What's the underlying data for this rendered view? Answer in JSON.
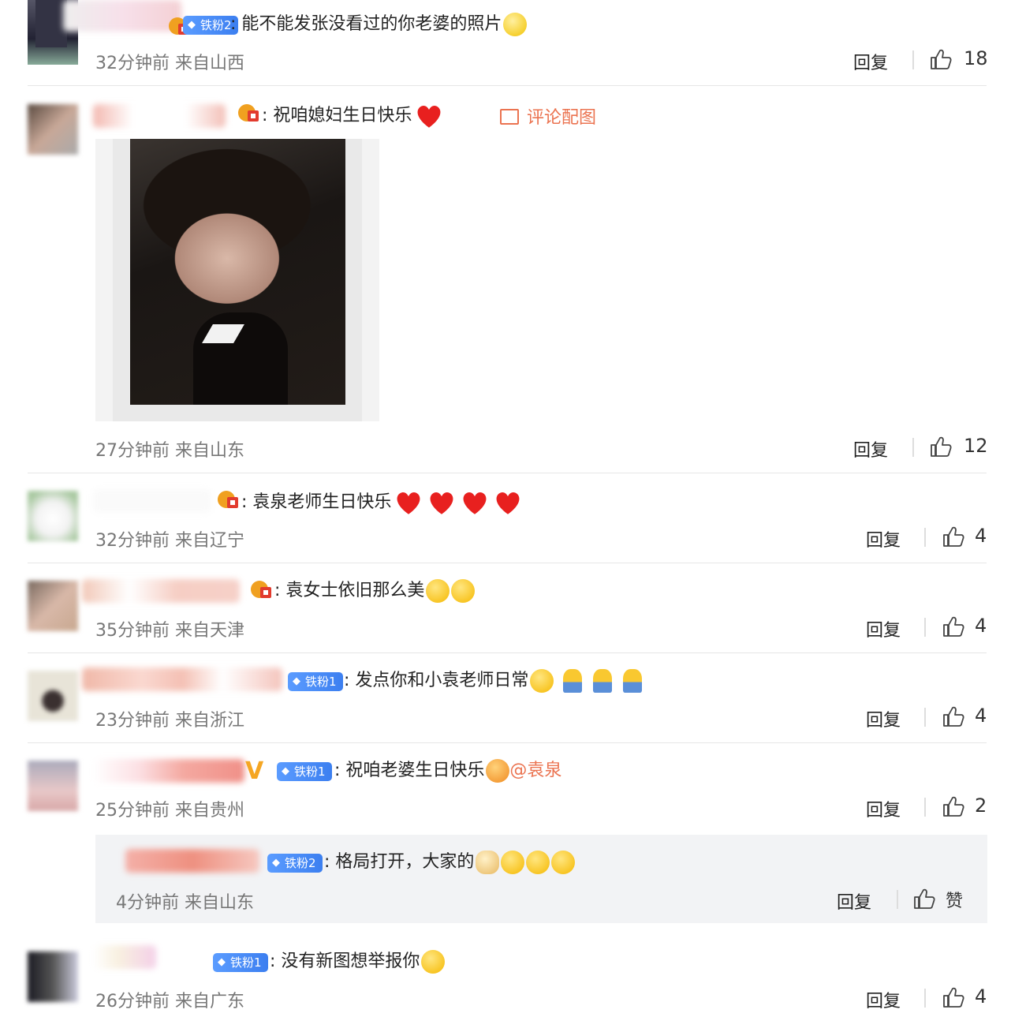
{
  "comments": [
    {
      "badge": "铁粉2",
      "text": "能不能发张没看过的你老婆的照片",
      "time": "32分钟前",
      "source": "来自山西",
      "reply_label": "回复",
      "likes": "18"
    },
    {
      "text": "祝咱媳妇生日快乐",
      "image_link": "评论配图",
      "time": "27分钟前",
      "source": "来自山东",
      "reply_label": "回复",
      "likes": "12"
    },
    {
      "text": "袁泉老师生日快乐",
      "time": "32分钟前",
      "source": "来自辽宁",
      "reply_label": "回复",
      "likes": "4"
    },
    {
      "text": "袁女士依旧那么美",
      "time": "35分钟前",
      "source": "来自天津",
      "reply_label": "回复",
      "likes": "4"
    },
    {
      "badge": "铁粉1",
      "text": "发点你和小袁老师日常",
      "time": "23分钟前",
      "source": "来自浙江",
      "reply_label": "回复",
      "likes": "4"
    },
    {
      "badge": "铁粉1",
      "text": "祝咱老婆生日快乐",
      "mention": "@袁泉",
      "time": "25分钟前",
      "source": "来自贵州",
      "reply_label": "回复",
      "likes": "2",
      "sub_reply": {
        "badge": "铁粉2",
        "text": "格局打开，大家的",
        "time": "4分钟前",
        "source": "来自山东",
        "reply_label": "回复",
        "likes": "赞"
      }
    },
    {
      "badge": "铁粉1",
      "text": "没有新图想举报你",
      "time": "26分钟前",
      "source": "来自广东",
      "reply_label": "回复",
      "likes": "4"
    }
  ],
  "colors": {
    "accent": "#eb7350",
    "badge": "#3c7ff0",
    "heart": "#e8201f"
  }
}
